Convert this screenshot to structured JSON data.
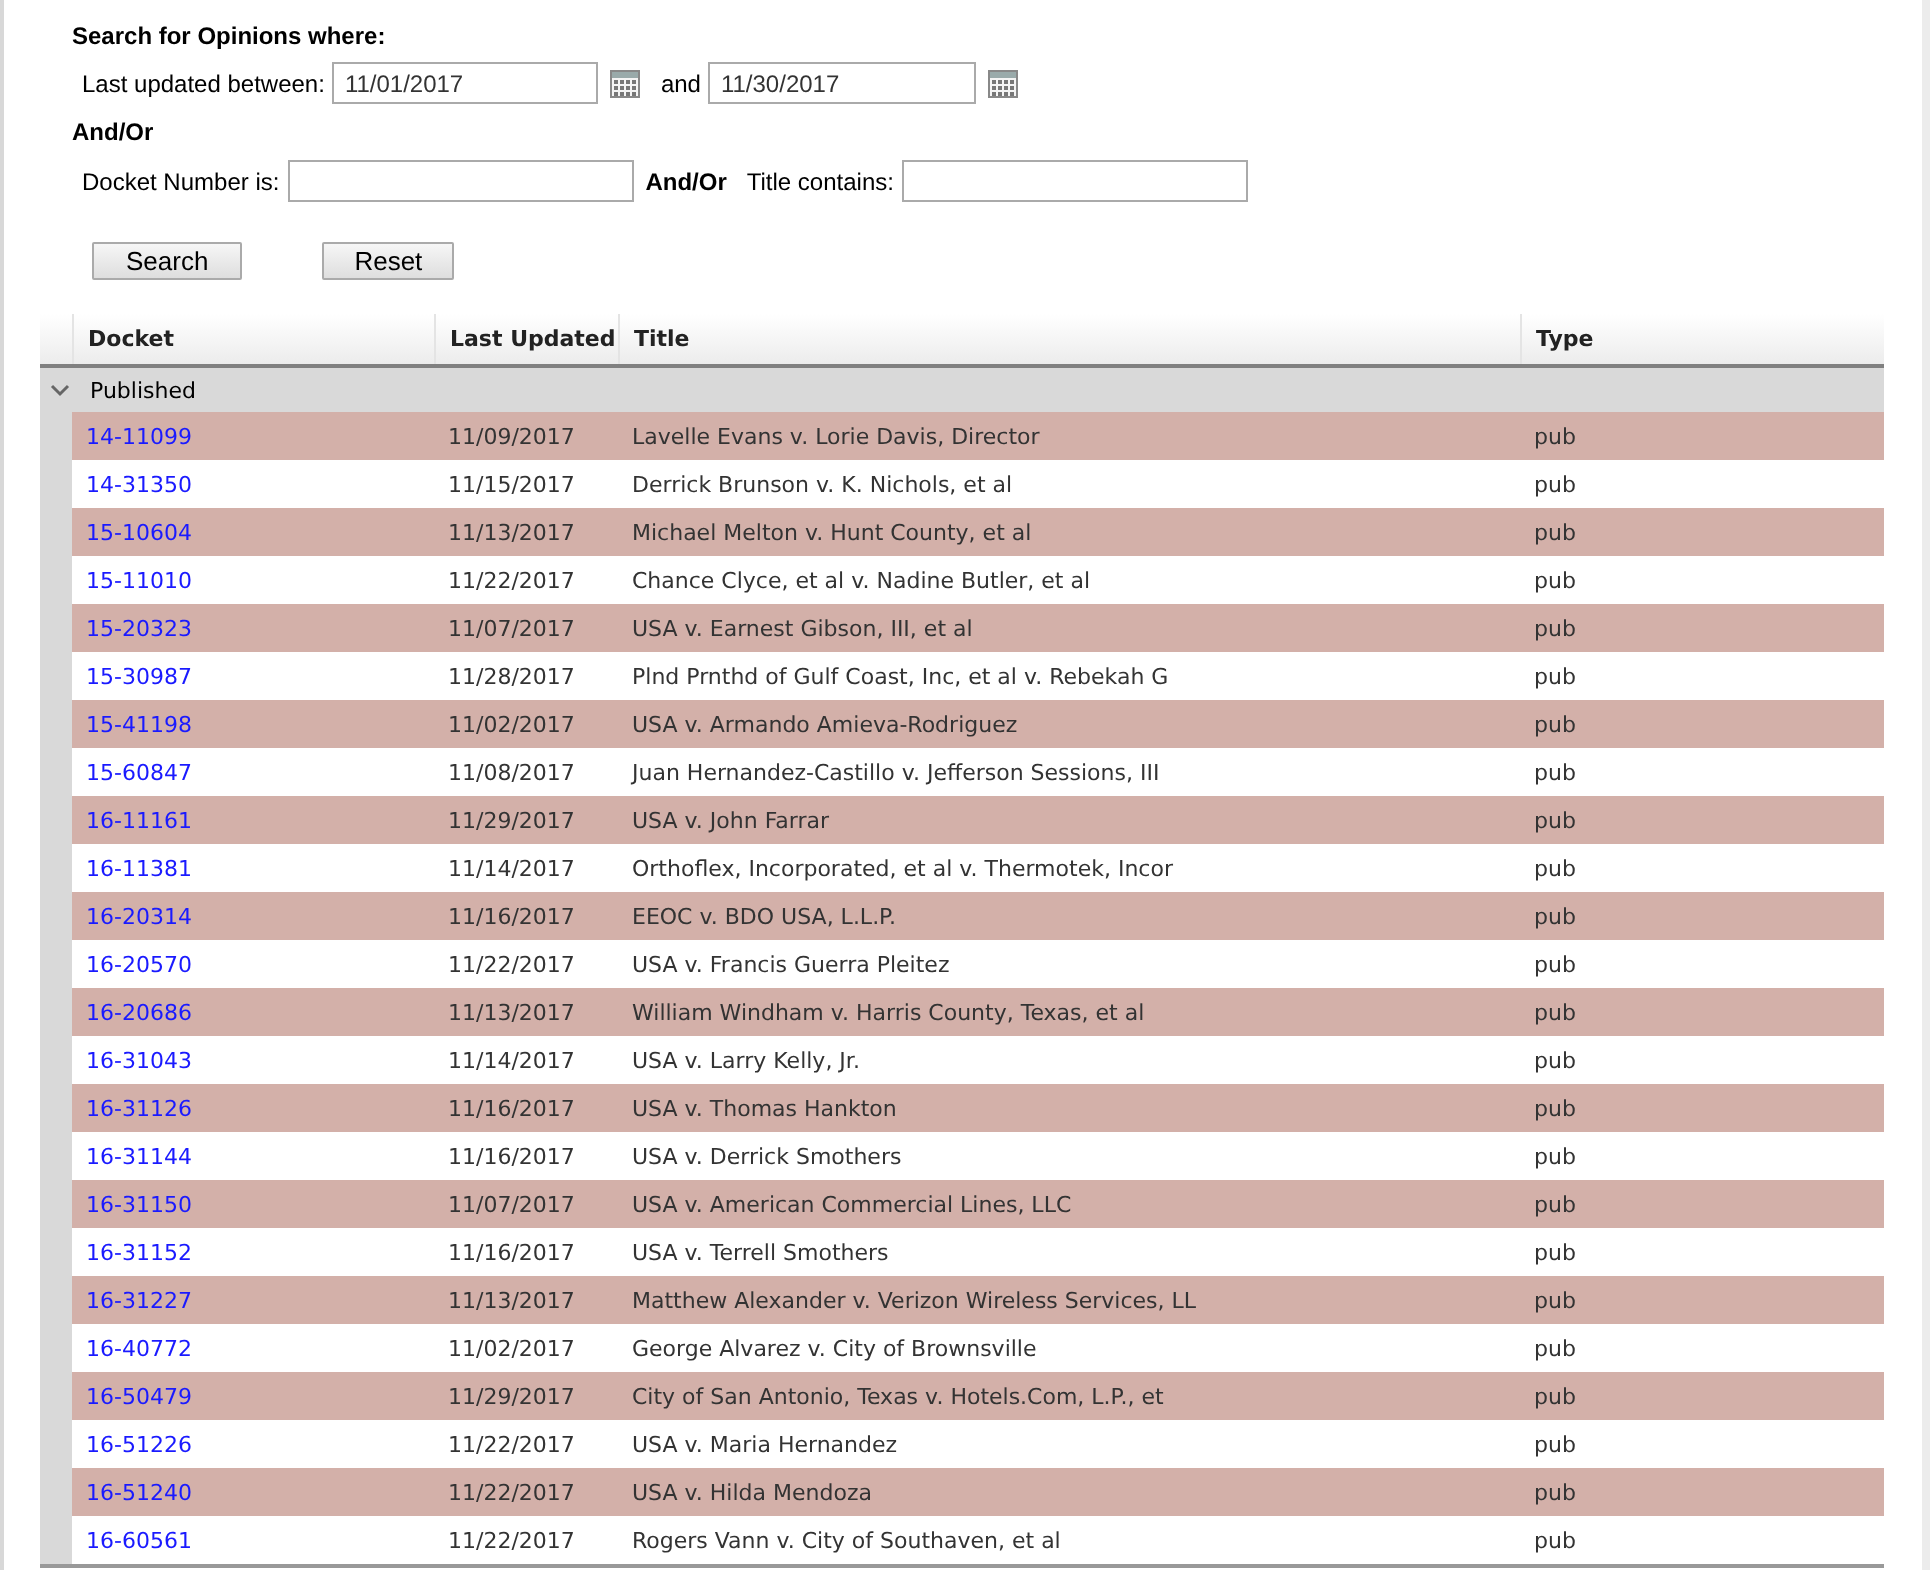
{
  "search_form": {
    "heading": "Search for Opinions where:",
    "date_label": "Last updated between:",
    "date_from": "11/01/2017",
    "date_joiner": "and",
    "date_to": "11/30/2017",
    "and_or_line": "And/Or",
    "docket_label": "Docket Number is:",
    "docket_and_or": "And/Or",
    "title_label": "Title contains:",
    "buttons": [
      "Search",
      "Reset"
    ]
  },
  "table": {
    "columns": [
      "Docket",
      "Last Updated",
      "Title",
      "Type"
    ],
    "group": {
      "label": "Published",
      "expanded": true
    },
    "rows": [
      {
        "docket": "14-11099",
        "updated": "11/09/2017",
        "title": "Lavelle Evans v. Lorie Davis, Director",
        "type": "pub"
      },
      {
        "docket": "14-31350",
        "updated": "11/15/2017",
        "title": "Derrick Brunson v. K. Nichols, et al",
        "type": "pub"
      },
      {
        "docket": "15-10604",
        "updated": "11/13/2017",
        "title": "Michael Melton v. Hunt County, et al",
        "type": "pub"
      },
      {
        "docket": "15-11010",
        "updated": "11/22/2017",
        "title": "Chance Clyce, et al v. Nadine Butler, et al",
        "type": "pub"
      },
      {
        "docket": "15-20323",
        "updated": "11/07/2017",
        "title": "USA v. Earnest Gibson, III, et al",
        "type": "pub"
      },
      {
        "docket": "15-30987",
        "updated": "11/28/2017",
        "title": "Plnd Prnthd of Gulf Coast, Inc, et al v. Rebekah G",
        "type": "pub"
      },
      {
        "docket": "15-41198",
        "updated": "11/02/2017",
        "title": "USA v. Armando Amieva-Rodriguez",
        "type": "pub"
      },
      {
        "docket": "15-60847",
        "updated": "11/08/2017",
        "title": "Juan Hernandez-Castillo v. Jefferson Sessions, III",
        "type": "pub"
      },
      {
        "docket": "16-11161",
        "updated": "11/29/2017",
        "title": "USA v. John Farrar",
        "type": "pub"
      },
      {
        "docket": "16-11381",
        "updated": "11/14/2017",
        "title": "Orthoflex, Incorporated, et al v. Thermotek, Incor",
        "type": "pub"
      },
      {
        "docket": "16-20314",
        "updated": "11/16/2017",
        "title": "EEOC v. BDO USA, L.L.P.",
        "type": "pub"
      },
      {
        "docket": "16-20570",
        "updated": "11/22/2017",
        "title": "USA v. Francis Guerra Pleitez",
        "type": "pub"
      },
      {
        "docket": "16-20686",
        "updated": "11/13/2017",
        "title": "William Windham v. Harris County, Texas, et al",
        "type": "pub"
      },
      {
        "docket": "16-31043",
        "updated": "11/14/2017",
        "title": "USA v. Larry Kelly, Jr.",
        "type": "pub"
      },
      {
        "docket": "16-31126",
        "updated": "11/16/2017",
        "title": "USA v. Thomas Hankton",
        "type": "pub"
      },
      {
        "docket": "16-31144",
        "updated": "11/16/2017",
        "title": "USA v. Derrick Smothers",
        "type": "pub"
      },
      {
        "docket": "16-31150",
        "updated": "11/07/2017",
        "title": "USA v. American Commercial Lines, LLC",
        "type": "pub"
      },
      {
        "docket": "16-31152",
        "updated": "11/16/2017",
        "title": "USA v. Terrell Smothers",
        "type": "pub"
      },
      {
        "docket": "16-31227",
        "updated": "11/13/2017",
        "title": "Matthew Alexander v. Verizon Wireless Services, LL",
        "type": "pub"
      },
      {
        "docket": "16-40772",
        "updated": "11/02/2017",
        "title": "George Alvarez v. City of Brownsville",
        "type": "pub"
      },
      {
        "docket": "16-50479",
        "updated": "11/29/2017",
        "title": "City of San Antonio, Texas v. Hotels.Com, L.P., et",
        "type": "pub"
      },
      {
        "docket": "16-51226",
        "updated": "11/22/2017",
        "title": "USA v. Maria Hernandez",
        "type": "pub"
      },
      {
        "docket": "16-51240",
        "updated": "11/22/2017",
        "title": "USA v. Hilda Mendoza",
        "type": "pub"
      },
      {
        "docket": "16-60561",
        "updated": "11/22/2017",
        "title": "Rogers Vann v. City of Southaven, et al",
        "type": "pub"
      }
    ]
  }
}
